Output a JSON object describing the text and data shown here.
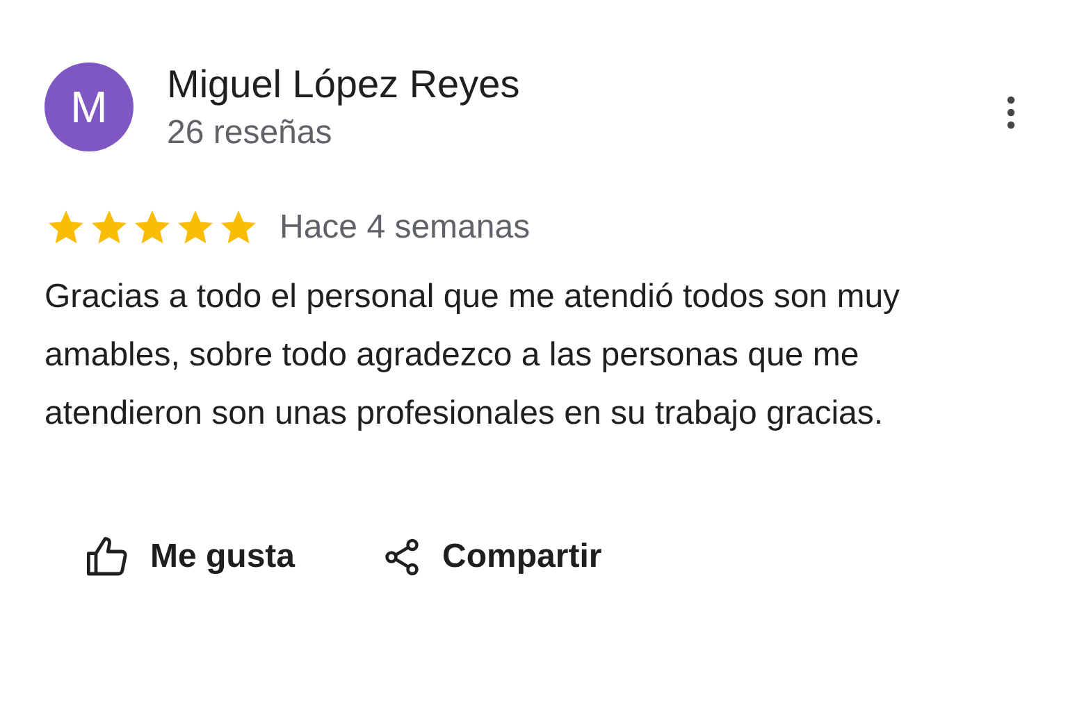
{
  "reviewer": {
    "initial": "M",
    "name": "Miguel López Reyes",
    "reviews": "26 reseñas"
  },
  "review": {
    "stars": 5,
    "time": "Hace 4 semanas",
    "text": "Gracias a todo el personal que me atendió todos son muy amables, sobre todo agradezco a las personas que me atendieron son unas profesionales en su trabajo gracias."
  },
  "actions": [
    {
      "kind": "like",
      "label": "Me gusta"
    },
    {
      "kind": "share",
      "label": "Compartir"
    }
  ]
}
